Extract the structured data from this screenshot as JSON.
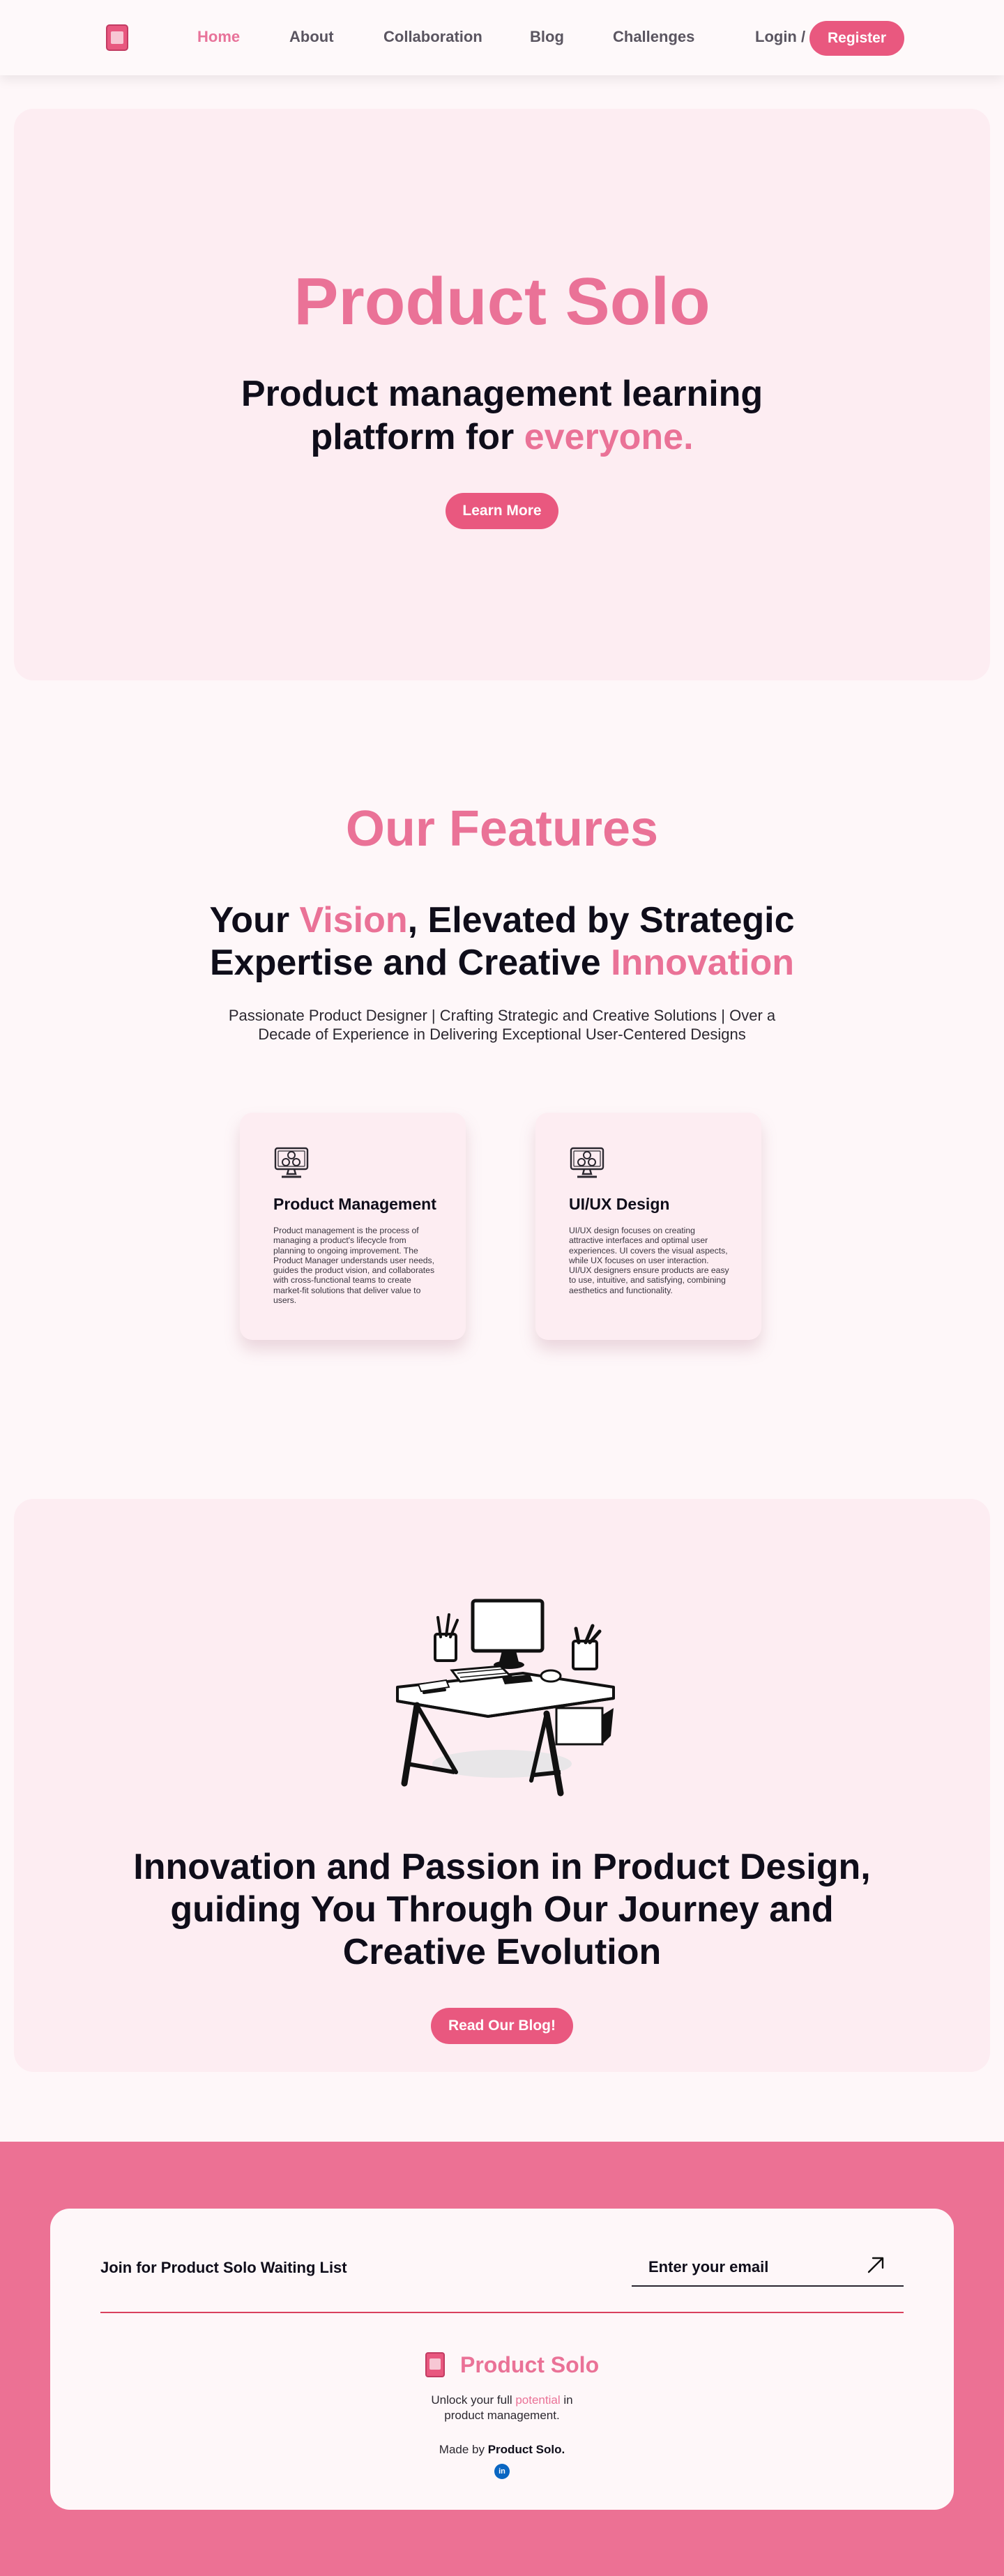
{
  "nav": {
    "links": [
      "Home",
      "About",
      "Collaboration",
      "Blog",
      "Challenges"
    ],
    "active": "Home",
    "login": "Login /",
    "register": "Register"
  },
  "hero": {
    "title": "Product Solo",
    "subtitle_line1": "Product management learning",
    "subtitle_line2_a": "platform for ",
    "subtitle_line2_b": "everyone.",
    "button": "Learn More"
  },
  "features": {
    "title": "Our Features",
    "sub_a": "Your ",
    "sub_b": "Vision",
    "sub_c": ", Elevated by Strategic",
    "sub_d": "Expertise and Creative ",
    "sub_e": "Innovation",
    "description": "Passionate Product Designer | Crafting Strategic and Creative Solutions | Over a Decade of Experience in Delivering Exceptional User-Centered Designs",
    "cards": [
      {
        "title": "Product Management",
        "text": "Product management is the process of managing a product's lifecycle from planning to ongoing improvement. The Product Manager understands user needs, guides the product vision, and collaborates with cross-functional teams to create market-fit solutions that deliver value to users."
      },
      {
        "title": "UI/UX Design",
        "text": "UI/UX design focuses on creating attractive interfaces and optimal user experiences. UI covers the visual aspects, while UX focuses on user interaction. UI/UX designers ensure products are easy to use, intuitive, and satisfying, combining aesthetics and functionality."
      }
    ]
  },
  "innovation": {
    "line1": "Innovation and Passion in Product Design,",
    "line2": "guiding You Through Our Journey and",
    "line3": "Creative Evolution",
    "button": "Read Our Blog!"
  },
  "footer": {
    "waitlist_label": "Join for Product Solo Waiting List",
    "email_placeholder": "Enter your email",
    "brand": "Product Solo",
    "tag_a": "Unlock your full ",
    "tag_b": "potential",
    "tag_c": " in",
    "tag_d": "product management.",
    "made_a": "Made by ",
    "made_b": "Product Solo."
  },
  "colors": {
    "accent": "#ea7297",
    "button": "#e9587f",
    "footer_bg": "#ec7194",
    "section_bg": "#fdedf2",
    "page_bg": "#fef7f9"
  }
}
